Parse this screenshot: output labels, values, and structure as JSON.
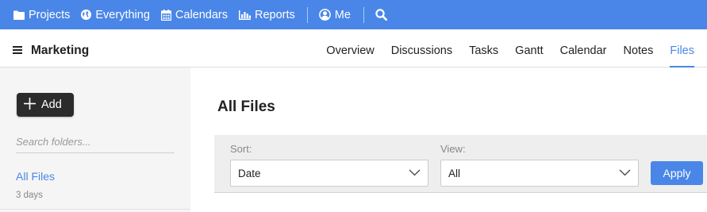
{
  "topnav": {
    "items": [
      {
        "label": "Projects",
        "icon": "folder-icon"
      },
      {
        "label": "Everything",
        "icon": "globe-icon"
      },
      {
        "label": "Calendars",
        "icon": "calendar-icon"
      },
      {
        "label": "Reports",
        "icon": "bar-chart-icon"
      }
    ],
    "me_label": "Me",
    "search_icon": "search-icon",
    "background": "#4a86e8"
  },
  "project": {
    "title": "Marketing",
    "tabs": [
      {
        "label": "Overview",
        "active": false
      },
      {
        "label": "Discussions",
        "active": false
      },
      {
        "label": "Tasks",
        "active": false
      },
      {
        "label": "Gantt",
        "active": false
      },
      {
        "label": "Calendar",
        "active": false
      },
      {
        "label": "Notes",
        "active": false
      },
      {
        "label": "Files",
        "active": true
      }
    ]
  },
  "sidebar": {
    "add_label": "Add",
    "search_placeholder": "Search folders...",
    "folders": [
      {
        "name": "All Files",
        "meta": "3 days"
      }
    ]
  },
  "main": {
    "title": "All Files",
    "filters": {
      "sort_label": "Sort:",
      "sort_value": "Date",
      "view_label": "View:",
      "view_value": "All",
      "apply_label": "Apply"
    }
  },
  "colors": {
    "accent": "#4a86e8",
    "sidebar_bg": "#f5f5f5",
    "filter_bg": "#eeeeee",
    "add_button_bg": "#2b2b2b"
  }
}
